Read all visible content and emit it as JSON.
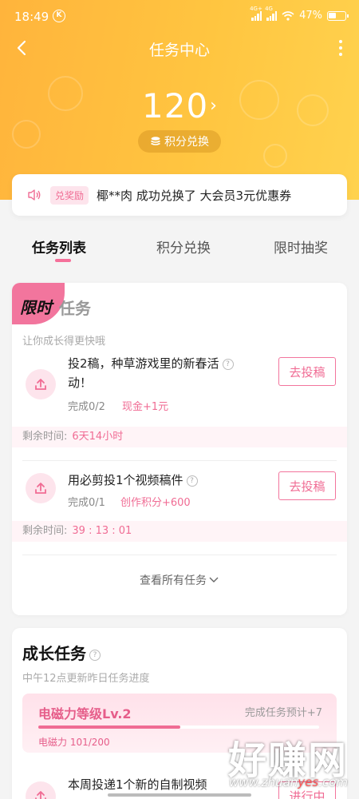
{
  "statusbar": {
    "time": "18:49",
    "k_badge": "K",
    "net1": "4G+",
    "net2": "4G",
    "battery": "47%"
  },
  "header": {
    "title": "任务中心",
    "points": "120",
    "points_chevron": "›",
    "exchange_label": "积分兑换"
  },
  "notice": {
    "badge": "兑奖励",
    "message": "椰**肉 成功兑换了 大会员3元优惠券"
  },
  "tabs": [
    {
      "label": "任务列表",
      "active": true
    },
    {
      "label": "积分兑换",
      "active": false
    },
    {
      "label": "限时抽奖",
      "active": false
    }
  ],
  "limited": {
    "badge": "限时",
    "title": "任务",
    "subtitle": "让你成长得更快哦",
    "tasks": [
      {
        "title_line1": "投2稿，种草游戏里的新春活",
        "title_line2": "动！",
        "progress": "完成0/2",
        "reward": "现金+1元",
        "button": "去投稿",
        "remain_label": "剩余时间:",
        "remain_value": "6天14小时"
      },
      {
        "title_line1": "用必剪投1个视频稿件",
        "progress": "完成0/1",
        "reward": "创作积分+600",
        "button": "去投稿",
        "remain_label": "剩余时间:",
        "remain_value": "39 : 13 : 01"
      }
    ],
    "see_all": "查看所有任务"
  },
  "growth": {
    "title": "成长任务",
    "subtitle": "中午12点更新昨日任务进度",
    "level": "电磁力等级Lv.2",
    "prediction": "完成任务预计+7",
    "value_text": "电磁力 101/200",
    "progress_fraction": 0.505,
    "task": {
      "title": "本周投递1个新的自制视频",
      "button": "进行中"
    }
  },
  "watermark": {
    "big": "好赚网",
    "small_a": "www.zhuan",
    "small_b": "yes",
    "small_c": ".com"
  },
  "colors": {
    "accent": "#f06c94",
    "hero": "#ffc540"
  },
  "icons": {
    "back": "back-arrow-icon",
    "more": "more-vertical-icon",
    "speaker": "speaker-icon",
    "upload": "upload-icon",
    "coin": "coin-stack-icon"
  }
}
